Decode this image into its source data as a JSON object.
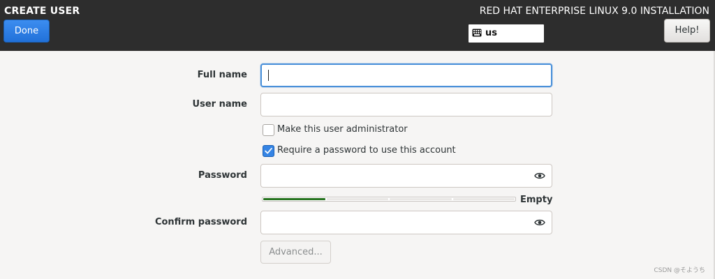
{
  "header": {
    "page_title": "CREATE USER",
    "done_label": "Done",
    "product_title": "RED HAT ENTERPRISE LINUX 9.0 INSTALLATION",
    "keyboard_layout": "us",
    "help_label": "Help!"
  },
  "form": {
    "full_name": {
      "label": "Full name",
      "value": ""
    },
    "user_name": {
      "label": "User name",
      "value": ""
    },
    "admin_checkbox": {
      "label": "Make this user administrator",
      "checked": false
    },
    "require_password_checkbox": {
      "label": "Require a password to use this account",
      "checked": true
    },
    "password": {
      "label": "Password",
      "value": ""
    },
    "strength": {
      "label": "Empty",
      "filled_segments": 1,
      "total_segments": 4,
      "fill_color": "#26731f"
    },
    "confirm_password": {
      "label": "Confirm password",
      "value": ""
    },
    "advanced_label": "Advanced..."
  },
  "icons": {
    "keyboard": "keyboard-icon",
    "reveal_password": "eye-icon",
    "checkmark": "checkmark-icon"
  },
  "colors": {
    "header_bg": "#2d2d2d",
    "accent": "#3584e4",
    "focus_border": "#4a90d9",
    "strength_fill": "#26731f"
  },
  "watermark": "CSDN @そようち"
}
